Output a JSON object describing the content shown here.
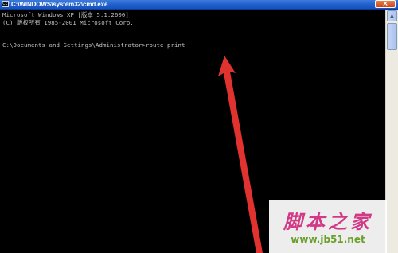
{
  "window": {
    "icon_glyph": "C:\\",
    "title": "C:\\WINDOWS\\system32\\cmd.exe",
    "close_glyph": "×"
  },
  "console": {
    "lines": [
      "Microsoft Windows XP [版本 5.1.2600]",
      "(C) 版权所有 1985-2001 Microsoft Corp.",
      "",
      "C:\\Documents and Settings\\Administrator>route print"
    ],
    "text_color": "#c0c0c0",
    "background": "#000000"
  },
  "scrollbar": {
    "up_glyph": "▲"
  },
  "annotation": {
    "color": "#e0322f",
    "icon": "red-arrow-pointing-up"
  },
  "watermark": {
    "chinese": "脚本之家",
    "url": "www.jb51.net"
  }
}
